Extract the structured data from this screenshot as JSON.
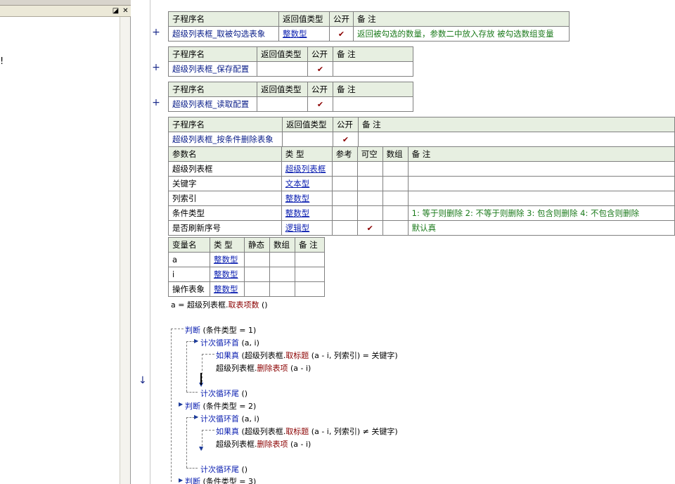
{
  "left_panel": {
    "header_icons": [
      "restore-icon",
      "close-icon"
    ],
    "restore_glyph": "◪",
    "close_glyph": "✕",
    "edge_mark": "!"
  },
  "gutter": {
    "plus": "+",
    "down_arrow": "↓"
  },
  "headers": {
    "sub_name": "子程序名",
    "return_type": "返回值类型",
    "public": "公开",
    "remark": "备 注",
    "param_name": "参数名",
    "type": "类 型",
    "ref": "参考",
    "nullable": "可空",
    "array": "数组",
    "var_name": "变量名",
    "static": "静态"
  },
  "check_mark": "✔",
  "subs": [
    {
      "name": "超级列表框_取被勾选表象",
      "return_type": "整数型",
      "public": true,
      "remark": "返回被勾选的数量，参数二中放入存放 被勾选数组变量"
    },
    {
      "name": "超级列表框_保存配置",
      "return_type": "",
      "public": true,
      "remark": ""
    },
    {
      "name": "超级列表框_读取配置",
      "return_type": "",
      "public": true,
      "remark": ""
    },
    {
      "name": "超级列表框_按条件删除表象",
      "return_type": "",
      "public": true,
      "remark": ""
    }
  ],
  "params": [
    {
      "name": "超级列表框",
      "type": "超级列表框",
      "ref": false,
      "nullable": false,
      "array": false,
      "remark": ""
    },
    {
      "name": "关键字",
      "type": "文本型",
      "ref": false,
      "nullable": false,
      "array": false,
      "remark": ""
    },
    {
      "name": "列索引",
      "type": "整数型",
      "ref": false,
      "nullable": false,
      "array": false,
      "remark": ""
    },
    {
      "name": "条件类型",
      "type": "整数型",
      "ref": false,
      "nullable": false,
      "array": false,
      "remark": "1: 等于则删除  2: 不等于则删除 3: 包含则删除 4: 不包含则删除"
    },
    {
      "name": "是否刷新序号",
      "type": "逻辑型",
      "ref": false,
      "nullable": true,
      "array": false,
      "remark": "默认真"
    }
  ],
  "locals": [
    {
      "name": "a",
      "type": "整数型"
    },
    {
      "name": "i",
      "type": "整数型"
    },
    {
      "name": "操作表象",
      "type": "整数型"
    }
  ],
  "code": {
    "l1_var": "a = ",
    "l1_obj": "超级列表框.",
    "l1_method": "取表项数",
    "l1_args": " ()",
    "l2_kw": "判断",
    "l2_rest": " (条件类型 = 1)",
    "l3_kw": "计次循环首",
    "l3_rest": " (a, i)",
    "l4_kw": "如果真",
    "l4_a": " (超级列表框.",
    "l4_m": "取标题",
    "l4_b": " (a - i, 列索引) = 关键字)",
    "l5_obj": "超级列表框.",
    "l5_m": "删除表项",
    "l5_rest": " (a - i)",
    "l6_kw": "计次循环尾",
    "l6_rest": " ()",
    "l7_kw": "判断",
    "l7_rest": " (条件类型 = 2)",
    "l8_kw": "计次循环首",
    "l8_rest": " (a, i)",
    "l9_kw": "如果真",
    "l9_a": " (超级列表框.",
    "l9_m": "取标题",
    "l9_b": " (a - i, 列索引) ≠ 关键字)",
    "l10_obj": "超级列表框.",
    "l10_m": "删除表项",
    "l10_rest": " (a - i)",
    "l11_kw": "计次循环尾",
    "l11_rest": " ()",
    "l12_kw": "判断",
    "l12_rest": " (条件类型 = 3)"
  }
}
